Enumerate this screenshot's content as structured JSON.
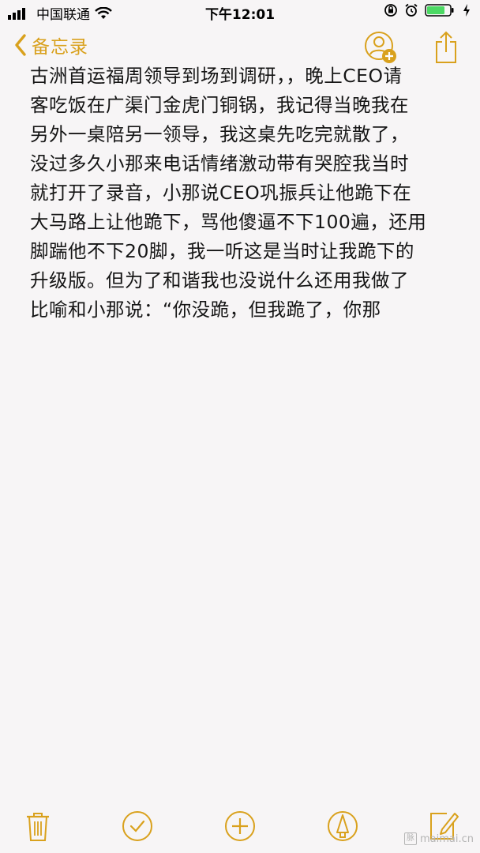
{
  "status_bar": {
    "carrier": "中国联通",
    "time": "下午12:01"
  },
  "nav": {
    "back_label": "备忘录",
    "icons": [
      "add-person-icon",
      "share-icon"
    ]
  },
  "note": {
    "lines": [
      "古洲首运福周领导到场到调研，，晚上CEO请",
      "客吃饭在广渠门金虎门铜锅，我记得当晚我在",
      "另外一桌陪另一领导，我这桌先吃完就散了，",
      "没过多久小那来电话情绪激动带有哭腔我当时",
      "就打开了录音，小那说CEO巩振兵让他跪下在",
      "大马路上让他跪下，骂他傻逼不下100遍，还用",
      "脚踹他不下20脚，我一听这是当时让我跪下的",
      "升级版。但为了和谐我也没说什么还用我做了",
      "比喻和小那说：“你没跪，但我跪了，你那"
    ]
  },
  "toolbar": {
    "icons": [
      "trash-icon",
      "checklist-icon",
      "add-icon",
      "markup-icon",
      "compose-icon"
    ]
  },
  "watermark": {
    "text": "maimai.cn"
  },
  "colors": {
    "accent": "#d9a11d",
    "background": "#f7f5f6",
    "text": "#151515"
  }
}
